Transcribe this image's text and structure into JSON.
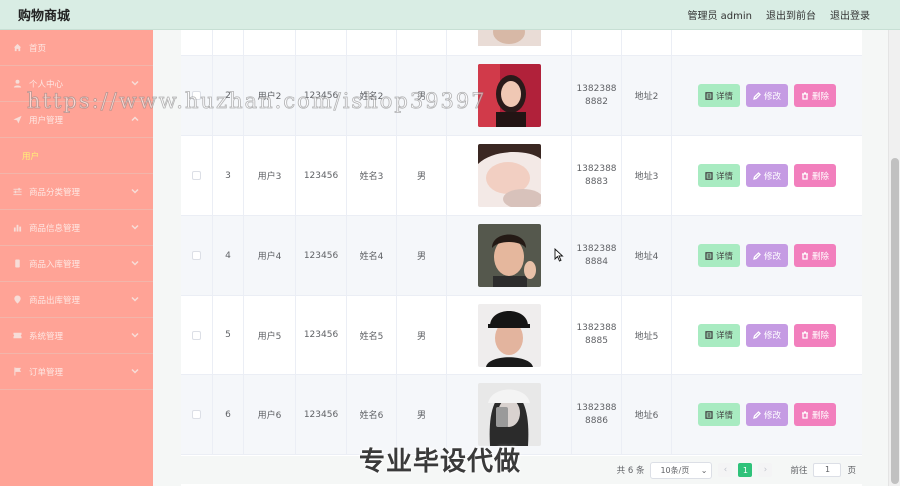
{
  "header": {
    "brand": "购物商城",
    "admin_label": "管理员 admin",
    "to_front": "退出到前台",
    "logout": "退出登录"
  },
  "sidebar": {
    "items": [
      {
        "label": "首页",
        "icon": "home-icon",
        "has_children": false
      },
      {
        "label": "个人中心",
        "icon": "user-icon",
        "has_children": true
      },
      {
        "label": "用户管理",
        "icon": "send-icon",
        "has_children": true,
        "expanded": true
      },
      {
        "label": "商品分类管理",
        "icon": "sliders-icon",
        "has_children": true
      },
      {
        "label": "商品信息管理",
        "icon": "bar-chart-icon",
        "has_children": true
      },
      {
        "label": "商品入库管理",
        "icon": "phone-icon",
        "has_children": true
      },
      {
        "label": "商品出库管理",
        "icon": "location-icon",
        "has_children": true
      },
      {
        "label": "系统管理",
        "icon": "ticket-icon",
        "has_children": true
      },
      {
        "label": "订单管理",
        "icon": "flag-icon",
        "has_children": true
      }
    ],
    "submenu_active": "用户"
  },
  "table": {
    "rows": [
      {
        "index": "2",
        "username": "用户2",
        "password": "123456",
        "name": "姓名2",
        "gender": "男",
        "phone_line1": "1382388",
        "phone_line2": "8882",
        "address": "地址2"
      },
      {
        "index": "3",
        "username": "用户3",
        "password": "123456",
        "name": "姓名3",
        "gender": "男",
        "phone_line1": "1382388",
        "phone_line2": "8883",
        "address": "地址3"
      },
      {
        "index": "4",
        "username": "用户4",
        "password": "123456",
        "name": "姓名4",
        "gender": "男",
        "phone_line1": "1382388",
        "phone_line2": "8884",
        "address": "地址4"
      },
      {
        "index": "5",
        "username": "用户5",
        "password": "123456",
        "name": "姓名5",
        "gender": "男",
        "phone_line1": "1382388",
        "phone_line2": "8885",
        "address": "地址5"
      },
      {
        "index": "6",
        "username": "用户6",
        "password": "123456",
        "name": "姓名6",
        "gender": "男",
        "phone_line1": "1382388",
        "phone_line2": "8886",
        "address": "地址6"
      }
    ],
    "actions": {
      "detail": "详情",
      "edit": "修改",
      "delete": "删除"
    }
  },
  "pagination": {
    "total": "共 6 条",
    "page_size": "10条/页",
    "current_page": "1",
    "goto_prefix": "前往",
    "goto_value": "1",
    "goto_suffix": "页"
  },
  "overlay": {
    "watermark": "https://www.huzhan.com/ishop39397",
    "banner": "专业毕设代做"
  },
  "colors": {
    "sidebar_bg": "#ffa396",
    "header_bg": "#d9ede4",
    "detail_btn": "#a8ebc1",
    "edit_btn": "#c59be3",
    "delete_btn": "#f27fbd",
    "active_page": "#2fc27a",
    "submenu_active_text": "#ffee77"
  }
}
